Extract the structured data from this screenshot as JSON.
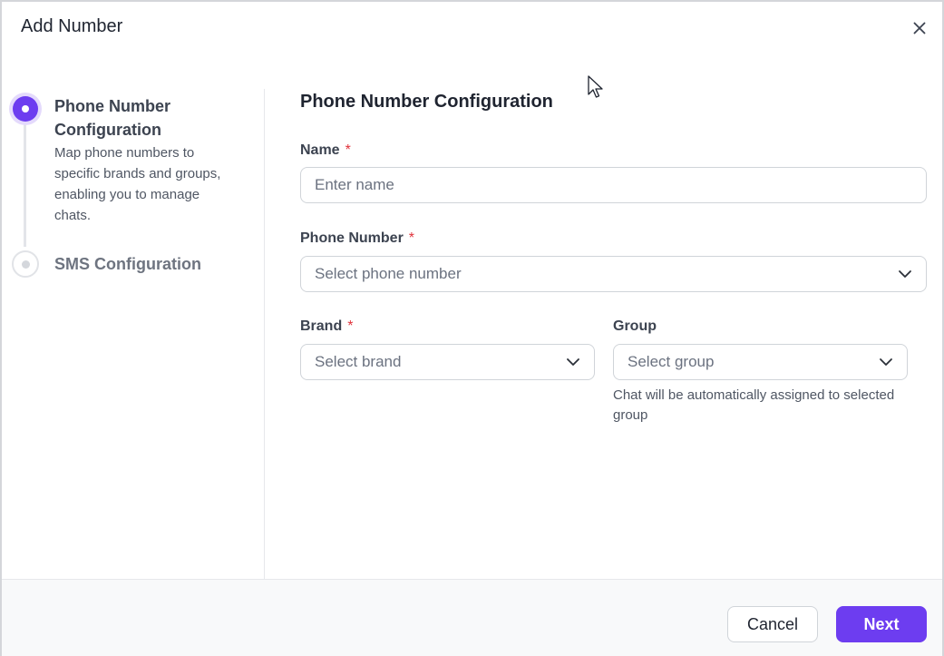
{
  "dialog": {
    "title": "Add Number",
    "close_icon": "close-icon"
  },
  "stepper": {
    "steps": [
      {
        "title": "Phone Number Configuration",
        "description": "Map phone numbers to specific brands and groups, enabling you to manage chats.",
        "state": "active"
      },
      {
        "title": "SMS Configuration",
        "state": "pending"
      }
    ]
  },
  "form": {
    "section_title": "Phone Number Configuration",
    "name": {
      "label": "Name",
      "required_mark": "*",
      "placeholder": "Enter name",
      "value": ""
    },
    "phone": {
      "label": "Phone Number",
      "required_mark": "*",
      "placeholder": "Select phone number"
    },
    "brand": {
      "label": "Brand",
      "required_mark": "*",
      "placeholder": "Select brand"
    },
    "group": {
      "label": "Group",
      "placeholder": "Select group",
      "helper": "Chat will be automatically assigned to selected group"
    }
  },
  "footer": {
    "cancel_label": "Cancel",
    "next_label": "Next"
  },
  "colors": {
    "accent": "#6d3df0",
    "required": "#e0323b"
  }
}
